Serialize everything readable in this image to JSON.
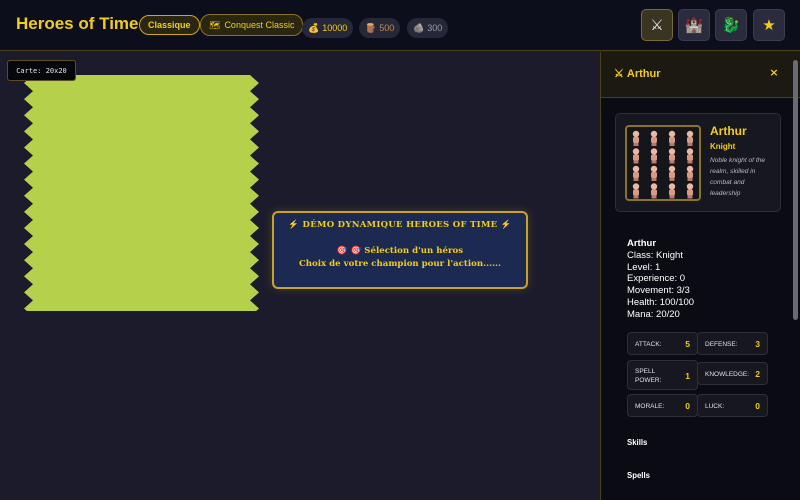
{
  "app": {
    "title": "Heroes of Time",
    "mode_badge": "Classique",
    "scenario_badge": "Conquest Classic",
    "scenario_icon": "map-icon"
  },
  "resources": {
    "gold": {
      "icon": "money-bag-icon",
      "value": "10000"
    },
    "wood": {
      "icon": "wood-icon",
      "value": "500"
    },
    "stone": {
      "icon": "stone-icon",
      "value": "300"
    }
  },
  "toolbar": {
    "buttons": [
      {
        "name": "crossed-swords-icon",
        "glyph": "⚔"
      },
      {
        "name": "castle-icon",
        "glyph": "🏰"
      },
      {
        "name": "dragon-icon",
        "glyph": "🐉"
      },
      {
        "name": "star-icon",
        "glyph": "★"
      }
    ]
  },
  "map": {
    "label": "Carte: 20x20",
    "hex_color": "#b5d14c"
  },
  "demo": {
    "title": "⚡ DÉMO DYNAMIQUE HEROES OF TIME ⚡",
    "subtitle": "🎯 🎯 Sélection d'un héros",
    "description": "Choix de votre champion pour l'action......"
  },
  "panel": {
    "title": "Arthur",
    "title_icon": "crossed-swords-icon",
    "close": "×",
    "hero": {
      "name": "Arthur",
      "class": "Knight",
      "description": "Noble knight of the realm, skilled in combat and leadership"
    },
    "info": {
      "name": "Arthur",
      "lines": [
        "Class: Knight",
        "Level: 1",
        "Experience: 0",
        "Movement: 3/3",
        "Health: 100/100",
        "Mana: 20/20"
      ]
    },
    "stats": {
      "attack": {
        "label": "ATTACK:",
        "value": "5"
      },
      "defense": {
        "label": "DEFENSE:",
        "value": "3"
      },
      "spell_power": {
        "label": "SPELL POWER:",
        "value": "1"
      },
      "knowledge": {
        "label": "KNOWLEDGE:",
        "value": "2"
      },
      "morale": {
        "label": "MORALE:",
        "value": "0"
      },
      "luck": {
        "label": "LUCK:",
        "value": "0"
      }
    },
    "sections": {
      "skills": "Skills",
      "spells": "Spells"
    }
  },
  "colors": {
    "accent": "#f2cd1a",
    "background": "#1b1b2c",
    "panel_bg": "#0b0b13",
    "demo_bg": "#1c2a52"
  }
}
